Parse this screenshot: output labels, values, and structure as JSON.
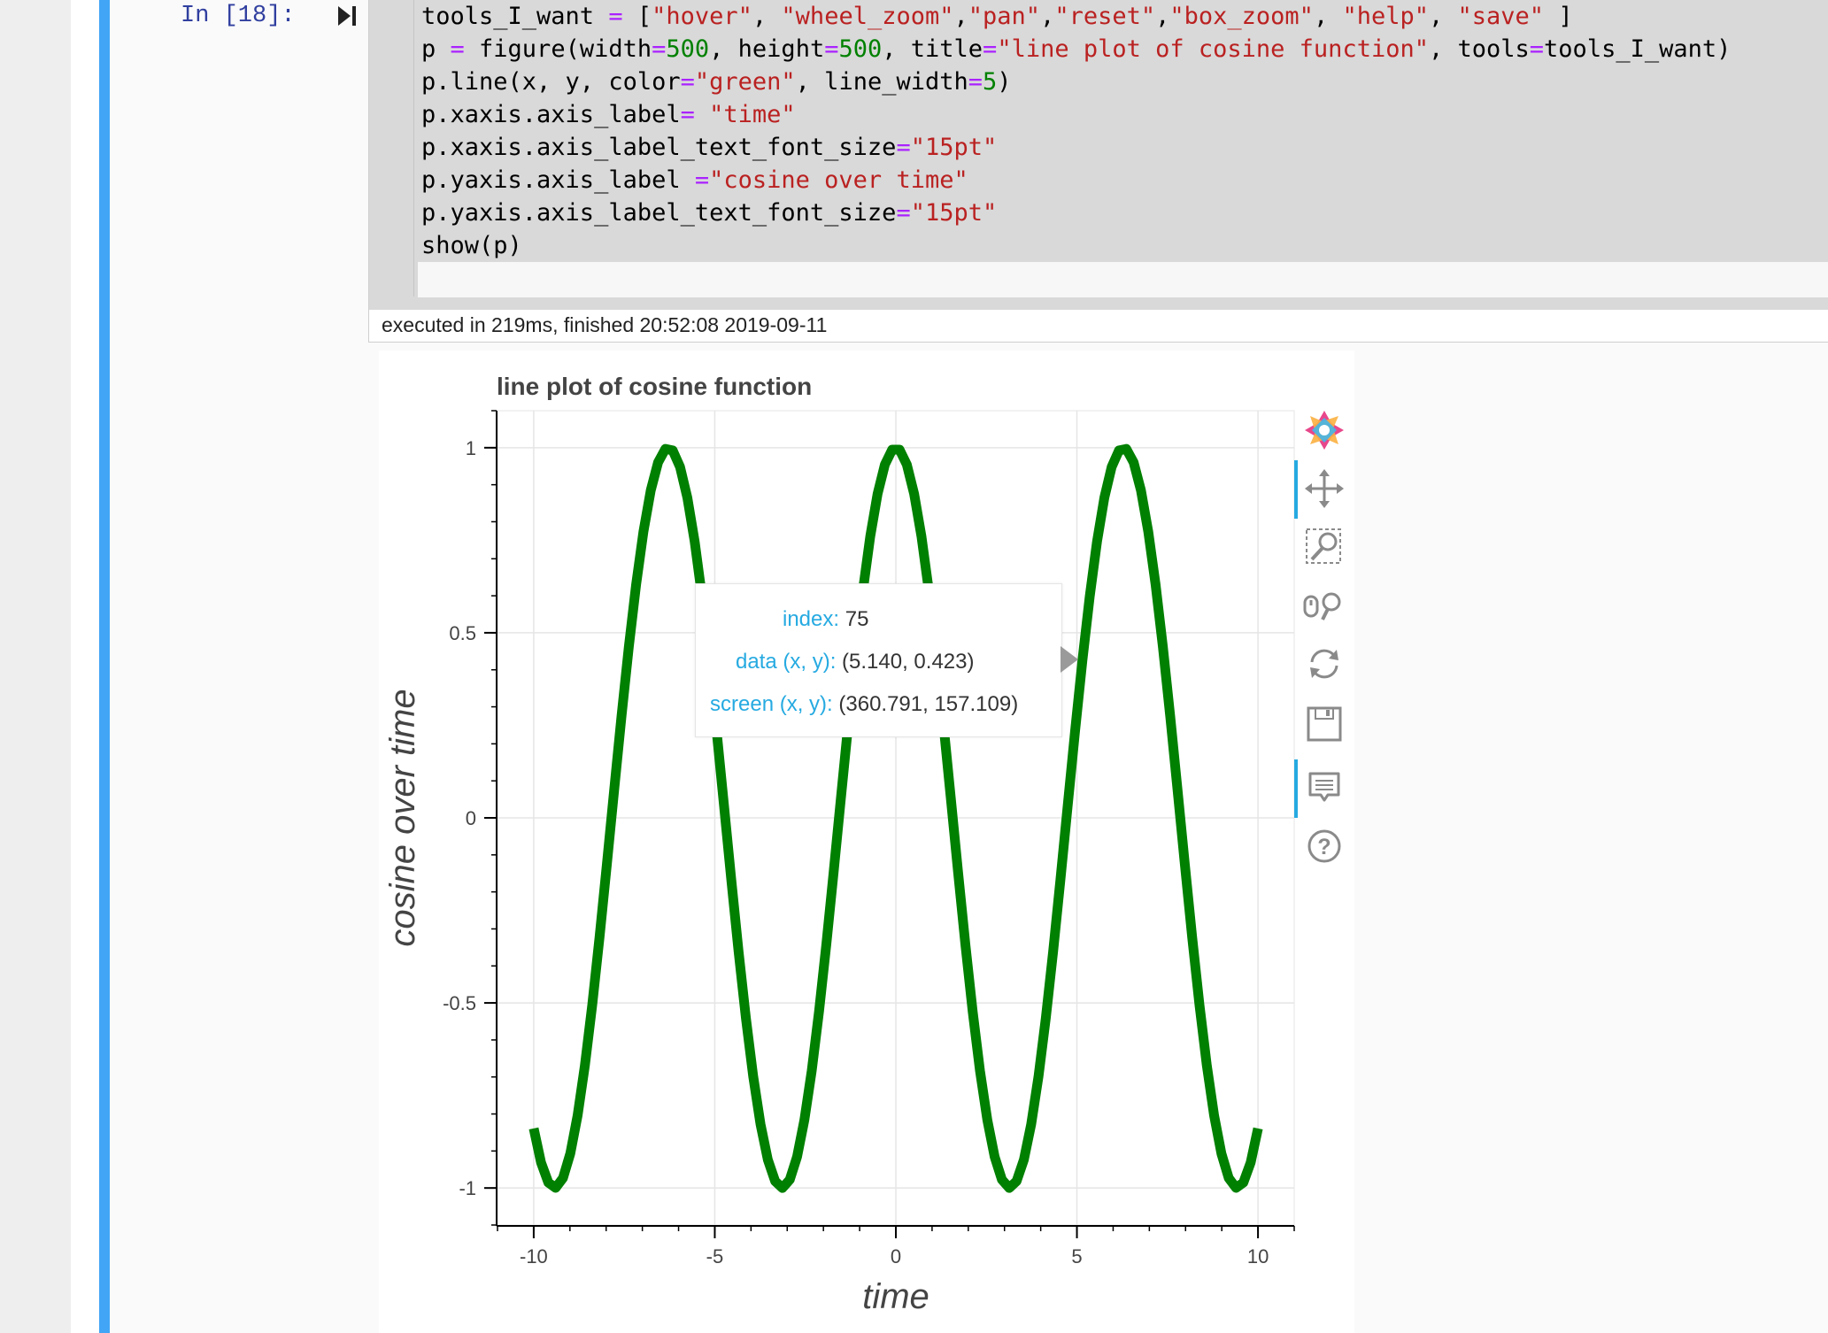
{
  "cell": {
    "prompt": "In [18]:",
    "code_lines": [
      {
        "parts": [
          {
            "t": "tools_I_want ",
            "c": ""
          },
          {
            "t": "=",
            "c": "op"
          },
          {
            "t": " [",
            "c": ""
          },
          {
            "t": "\"hover\"",
            "c": "str"
          },
          {
            "t": ", ",
            "c": ""
          },
          {
            "t": "\"wheel_zoom\"",
            "c": "str"
          },
          {
            "t": ",",
            "c": ""
          },
          {
            "t": "\"pan\"",
            "c": "str"
          },
          {
            "t": ",",
            "c": ""
          },
          {
            "t": "\"reset\"",
            "c": "str"
          },
          {
            "t": ",",
            "c": ""
          },
          {
            "t": "\"box_zoom\"",
            "c": "str"
          },
          {
            "t": ", ",
            "c": ""
          },
          {
            "t": "\"help\"",
            "c": "str"
          },
          {
            "t": ", ",
            "c": ""
          },
          {
            "t": "\"save\"",
            "c": "str"
          },
          {
            "t": " ]",
            "c": ""
          }
        ]
      },
      {
        "parts": [
          {
            "t": "p ",
            "c": ""
          },
          {
            "t": "=",
            "c": "op"
          },
          {
            "t": " figure(width",
            "c": ""
          },
          {
            "t": "=",
            "c": "op"
          },
          {
            "t": "500",
            "c": "num"
          },
          {
            "t": ", height",
            "c": ""
          },
          {
            "t": "=",
            "c": "op"
          },
          {
            "t": "500",
            "c": "num"
          },
          {
            "t": ", title",
            "c": ""
          },
          {
            "t": "=",
            "c": "op"
          },
          {
            "t": "\"line plot of cosine function\"",
            "c": "str"
          },
          {
            "t": ", tools",
            "c": ""
          },
          {
            "t": "=",
            "c": "op"
          },
          {
            "t": "tools_I_want)",
            "c": ""
          }
        ]
      },
      {
        "parts": [
          {
            "t": "p.line(x, y, color",
            "c": ""
          },
          {
            "t": "=",
            "c": "op"
          },
          {
            "t": "\"green\"",
            "c": "str"
          },
          {
            "t": ", line_width",
            "c": ""
          },
          {
            "t": "=",
            "c": "op"
          },
          {
            "t": "5",
            "c": "num"
          },
          {
            "t": ")",
            "c": ""
          }
        ]
      },
      {
        "parts": [
          {
            "t": "p.xaxis.axis_label",
            "c": ""
          },
          {
            "t": "=",
            "c": "op"
          },
          {
            "t": " ",
            "c": ""
          },
          {
            "t": "\"time\"",
            "c": "str"
          }
        ]
      },
      {
        "parts": [
          {
            "t": "p.xaxis.axis_label_text_font_size",
            "c": ""
          },
          {
            "t": "=",
            "c": "op"
          },
          {
            "t": "\"15pt\"",
            "c": "str"
          }
        ]
      },
      {
        "parts": [
          {
            "t": "p.yaxis.axis_label ",
            "c": ""
          },
          {
            "t": "=",
            "c": "op"
          },
          {
            "t": "\"cosine over time\"",
            "c": "str"
          }
        ]
      },
      {
        "parts": [
          {
            "t": "p.yaxis.axis_label_text_font_size",
            "c": ""
          },
          {
            "t": "=",
            "c": "op"
          },
          {
            "t": "\"15pt\"",
            "c": "str"
          }
        ]
      },
      {
        "parts": [
          {
            "t": "show(p)",
            "c": ""
          }
        ]
      }
    ],
    "exec_info": "executed in 219ms, finished 20:52:08 2019-09-11"
  },
  "chart_data": {
    "type": "line",
    "title": "line plot of cosine function",
    "xlabel": "time",
    "ylabel": "cosine over time",
    "xlim": [
      -11,
      11
    ],
    "ylim": [
      -1.1,
      1.1
    ],
    "x_ticks": [
      -10,
      -5,
      0,
      5,
      10
    ],
    "x_tick_labels": [
      "-10",
      "-5",
      "0",
      "5",
      "10"
    ],
    "y_ticks": [
      -1,
      -0.5,
      0,
      0.5,
      1
    ],
    "y_tick_labels": [
      "-1",
      "-0.5",
      "0",
      "0.5",
      "1"
    ],
    "grid": true,
    "series": [
      {
        "function": "cos",
        "x_start": -10,
        "x_end": 10,
        "points": 100,
        "color": "#008000",
        "line_width": 5
      }
    ]
  },
  "tooltip": {
    "rows": [
      {
        "label": "index:",
        "value": "75"
      },
      {
        "label": "data (x, y):",
        "value": "(5.140, 0.423)"
      },
      {
        "label": "screen (x, y):",
        "value": "(360.791, 157.109)"
      }
    ]
  },
  "toolbar": {
    "icons": [
      "bokeh-logo-icon",
      "pan-icon",
      "box-zoom-icon",
      "wheel-zoom-icon",
      "reset-icon",
      "save-icon",
      "hover-icon",
      "help-icon"
    ]
  },
  "colors": {
    "line": "#008000",
    "cell_bar": "#42a5f5",
    "tooltip_label": "#26aae1",
    "tool_active": "#26aae1"
  }
}
